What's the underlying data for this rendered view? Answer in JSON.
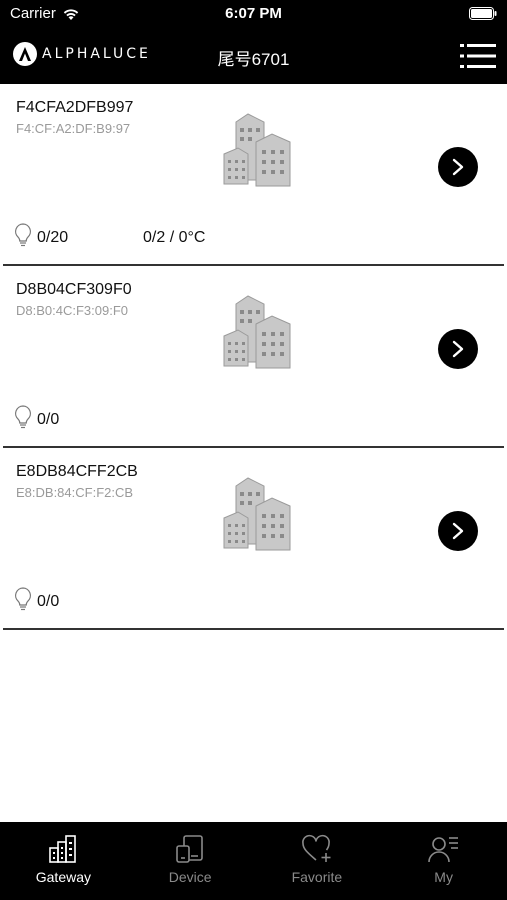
{
  "status_bar": {
    "carrier": "Carrier",
    "time": "6:07 PM"
  },
  "nav": {
    "logo_text": "ALPHALUCE",
    "title": "尾号6701"
  },
  "gateways": [
    {
      "name": "F4CFA2DFB997",
      "mac": "F4:CF:A2:DF:B9:97",
      "count": "0/20",
      "temp": "0/2 / 0°C"
    },
    {
      "name": "D8B04CF309F0",
      "mac": "D8:B0:4C:F3:09:F0",
      "count": "0/0",
      "temp": ""
    },
    {
      "name": "E8DB84CFF2CB",
      "mac": "E8:DB:84:CF:F2:CB",
      "count": "0/0",
      "temp": ""
    }
  ],
  "tabs": [
    {
      "label": "Gateway",
      "icon": "gateway-icon",
      "active": true
    },
    {
      "label": "Device",
      "icon": "device-icon",
      "active": false
    },
    {
      "label": "Favorite",
      "icon": "favorite-icon",
      "active": false
    },
    {
      "label": "My",
      "icon": "profile-icon",
      "active": false
    }
  ],
  "colors": {
    "bar": "#000000",
    "muted": "#9a9a9a",
    "active_tab": "#ffffff",
    "inactive_tab": "#8a8a8a"
  }
}
